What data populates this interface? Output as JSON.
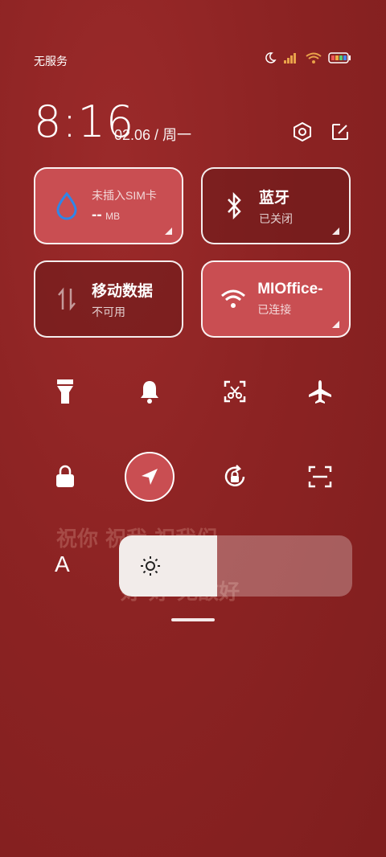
{
  "status_bar": {
    "carrier": "无服务",
    "icons": [
      "moon-icon",
      "signal-icon",
      "wifi-icon",
      "battery-icon"
    ]
  },
  "header": {
    "time": "8:16",
    "date": "02.06 / 周一",
    "icons": [
      "settings-icon",
      "edit-icon"
    ]
  },
  "tiles": [
    {
      "title": "--",
      "title_unit": "MB",
      "label": "未插入SIM卡",
      "icon": "water-drop-icon",
      "state": "active"
    },
    {
      "title": "蓝牙",
      "label": "已关闭",
      "icon": "bluetooth-icon",
      "state": "inactive"
    },
    {
      "title": "移动数据",
      "label": "不可用",
      "icon": "data-arrows-icon",
      "state": "inactive"
    },
    {
      "title": "MIOffice-",
      "label": "已连接",
      "icon": "wifi-icon",
      "state": "active"
    }
  ],
  "toggles_row1": [
    "flashlight-icon",
    "bell-icon",
    "screenshot-cut-icon",
    "airplane-icon"
  ],
  "toggles_row2": [
    "lock-icon",
    "location-icon",
    "rotation-lock-icon",
    "scan-icon"
  ],
  "brightness": {
    "auto_label": "A",
    "level": 0.42
  },
  "decor": {
    "row1": "祝你 祝我 祝我们",
    "row2": "好 好 无敌好"
  },
  "colors": {
    "background": "#8c2323",
    "tile_active": "#c94e52",
    "tile_inactive": "#6a1a1a",
    "accent_blue": "#2f86e8"
  }
}
